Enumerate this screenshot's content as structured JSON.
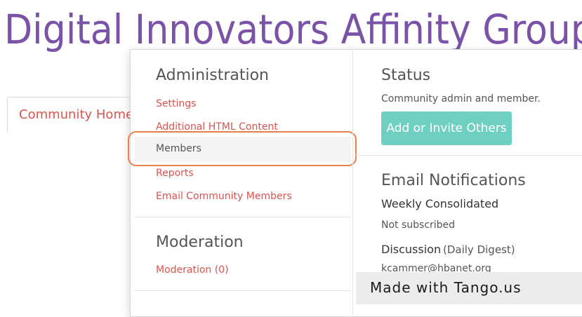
{
  "site": {
    "title": "Digital Innovators Affinity Group"
  },
  "tab": {
    "label": "Community Home"
  },
  "administration": {
    "heading": "Administration",
    "items": [
      {
        "label": "Settings"
      },
      {
        "label": "Additional HTML Content"
      },
      {
        "label": "Members"
      },
      {
        "label": "Reports"
      },
      {
        "label": "Email Community Members"
      }
    ]
  },
  "moderation": {
    "heading": "Moderation",
    "link": "Moderation (0)"
  },
  "status": {
    "heading": "Status",
    "text": "Community admin and member.",
    "button_label": "Add or Invite Others"
  },
  "email_notifications": {
    "heading": "Email Notifications",
    "weekly_label": "Weekly Consolidated",
    "weekly_value": "Not subscribed",
    "discussion_label": "Discussion",
    "discussion_freq": "(Daily Digest)",
    "email": "kcammer@hbanet.org"
  },
  "watermark": {
    "text": "Made with Tango.us"
  },
  "colors": {
    "title_purple": "#7a52a8",
    "link_red": "#d9534f",
    "button_teal": "#6fd0c1",
    "highlight_orange": "#e9804a"
  }
}
